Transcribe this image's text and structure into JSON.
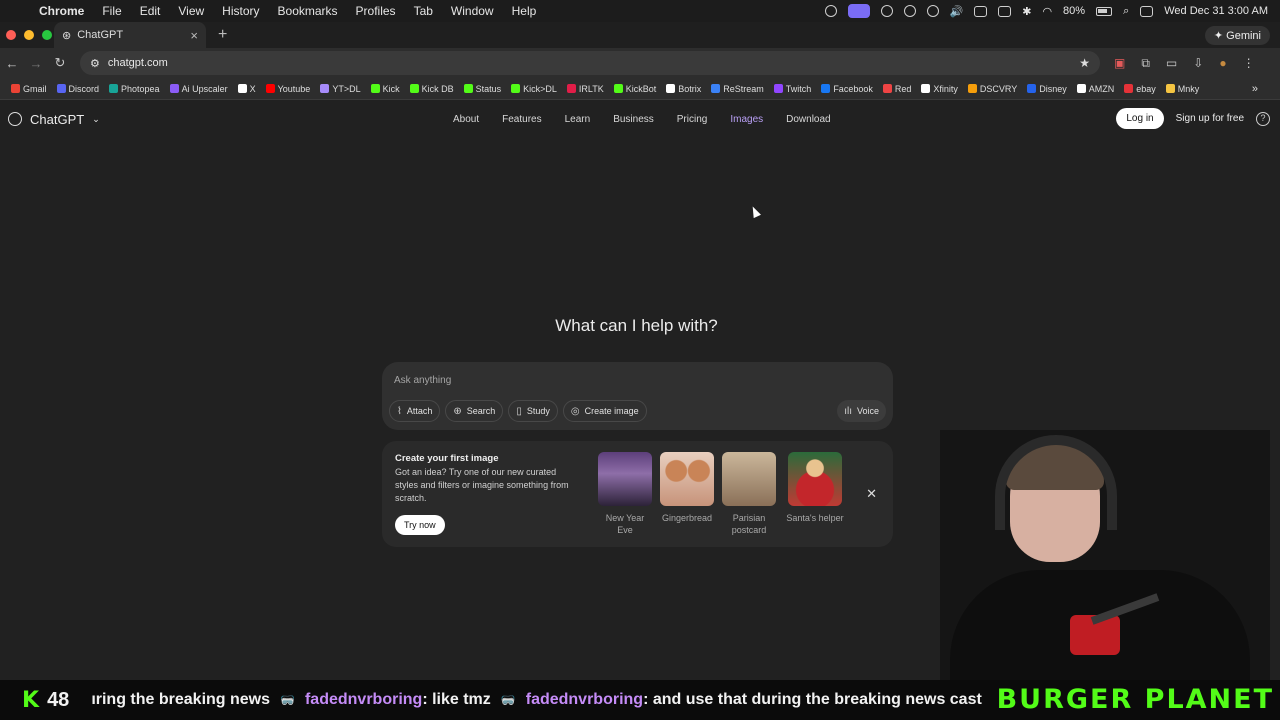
{
  "menubar": {
    "app": "Chrome",
    "items": [
      "File",
      "Edit",
      "View",
      "History",
      "Bookmarks",
      "Profiles",
      "Tab",
      "Window",
      "Help"
    ],
    "battery": "80%",
    "clock": "Wed Dec 31  3:00 AM"
  },
  "browser": {
    "tab_title": "ChatGPT",
    "url": "chatgpt.com",
    "gemini_label": "Gemini",
    "bookmarks": [
      {
        "label": "Gmail",
        "color": "#ea4335"
      },
      {
        "label": "Discord",
        "color": "#5865f2"
      },
      {
        "label": "Photopea",
        "color": "#18a497"
      },
      {
        "label": "Ai Upscaler",
        "color": "#8b5cf6"
      },
      {
        "label": "X",
        "color": "#ffffff"
      },
      {
        "label": "Youtube",
        "color": "#ff0000"
      },
      {
        "label": "YT>DL",
        "color": "#a78bfa"
      },
      {
        "label": "Kick",
        "color": "#53fc18"
      },
      {
        "label": "Kick DB",
        "color": "#53fc18"
      },
      {
        "label": "Status",
        "color": "#53fc18"
      },
      {
        "label": "Kick>DL",
        "color": "#53fc18"
      },
      {
        "label": "IRLTK",
        "color": "#e11d48"
      },
      {
        "label": "KickBot",
        "color": "#53fc18"
      },
      {
        "label": "Botrix",
        "color": "#ffffff"
      },
      {
        "label": "ReStream",
        "color": "#3b82f6"
      },
      {
        "label": "Twitch",
        "color": "#9146ff"
      },
      {
        "label": "Facebook",
        "color": "#1877f2"
      },
      {
        "label": "Red",
        "color": "#ef4444"
      },
      {
        "label": "Xfinity",
        "color": "#ffffff"
      },
      {
        "label": "DSCVRY",
        "color": "#f59e0b"
      },
      {
        "label": "Disney",
        "color": "#2563eb"
      },
      {
        "label": "AMZN",
        "color": "#ffffff"
      },
      {
        "label": "ebay",
        "color": "#e53238"
      },
      {
        "label": "Mnky",
        "color": "#f5c542"
      }
    ]
  },
  "chatgpt": {
    "brand": "ChatGPT",
    "nav": [
      "About",
      "Features",
      "Learn",
      "Business",
      "Pricing",
      "Images",
      "Download"
    ],
    "login_label": "Log in",
    "signup_label": "Sign up for free",
    "headline": "What can I help with?",
    "composer": {
      "placeholder": "Ask anything",
      "tools": [
        "Attach",
        "Search",
        "Study",
        "Create image"
      ],
      "voice_label": "Voice"
    },
    "promo": {
      "title": "Create your first image",
      "description": "Got an idea? Try one of our new curated styles and filters or imagine something from scratch.",
      "button": "Try now",
      "styles": [
        "New Year Eve",
        "Gingerbread",
        "Parisian postcard",
        "Santa's helper"
      ]
    }
  },
  "stream": {
    "viewer_count": "48",
    "ticker": {
      "fragment": "ıring the breaking news",
      "user1": "fadednvrboring",
      "msg1": ": like tmz",
      "user2": "fadednvrboring",
      "msg2": ": and use that during the breaking news cast"
    },
    "sponsor": "BURGER PLANET"
  }
}
